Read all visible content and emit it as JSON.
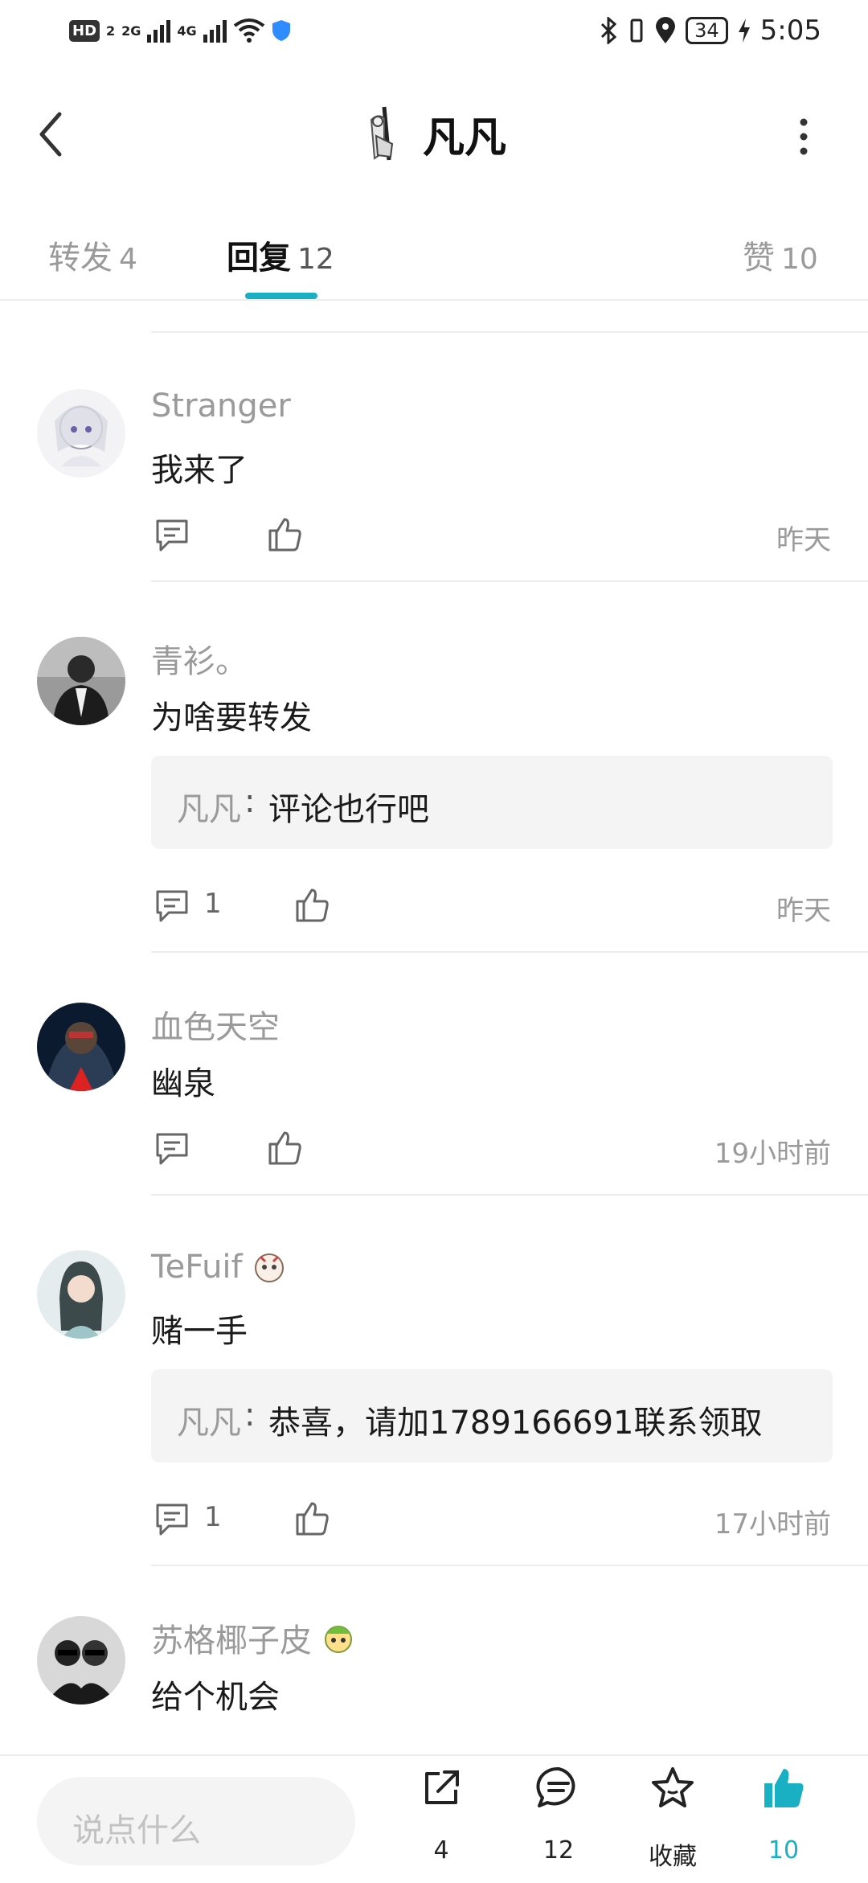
{
  "status_bar": {
    "left": {
      "hd": "HD",
      "sim": "2",
      "net1": "2G",
      "net2": "4G"
    },
    "time": "5:05",
    "battery": "34"
  },
  "header": {
    "title": "凡凡"
  },
  "tabs": [
    {
      "label": "转发",
      "count": "4"
    },
    {
      "label": "回复",
      "count": "12",
      "active": true
    },
    {
      "label": "赞",
      "count": "10"
    }
  ],
  "comments": [
    {
      "name": "Stranger",
      "text": "我来了",
      "time": "昨天",
      "reply_count": "",
      "reply": null
    },
    {
      "name": "青衫。",
      "text": "为啥要转发",
      "time": "昨天",
      "reply_count": "1",
      "reply": {
        "name": "凡凡",
        "colon": ":",
        "text": "评论也行吧"
      }
    },
    {
      "name": "血色天空",
      "text": "幽泉",
      "time": "19小时前",
      "reply_count": "",
      "reply": null
    },
    {
      "name": "TeFuif",
      "text": "赌一手",
      "time": "17小时前",
      "reply_count": "1",
      "reply": {
        "name": "凡凡",
        "colon": ":",
        "text": "恭喜，请加1789166691联系领取"
      }
    },
    {
      "name": "苏格椰子皮",
      "text": "给个机会",
      "time": "",
      "reply_count": "",
      "reply": null
    }
  ],
  "bottom_bar": {
    "input_placeholder": "说点什么",
    "share_count": "4",
    "comment_count": "12",
    "favorite_label": "收藏",
    "like_count": "10"
  },
  "colors": {
    "accent": "#1ab0c4",
    "muted": "#9a9a9a",
    "reply_bg": "#f4f4f4"
  }
}
